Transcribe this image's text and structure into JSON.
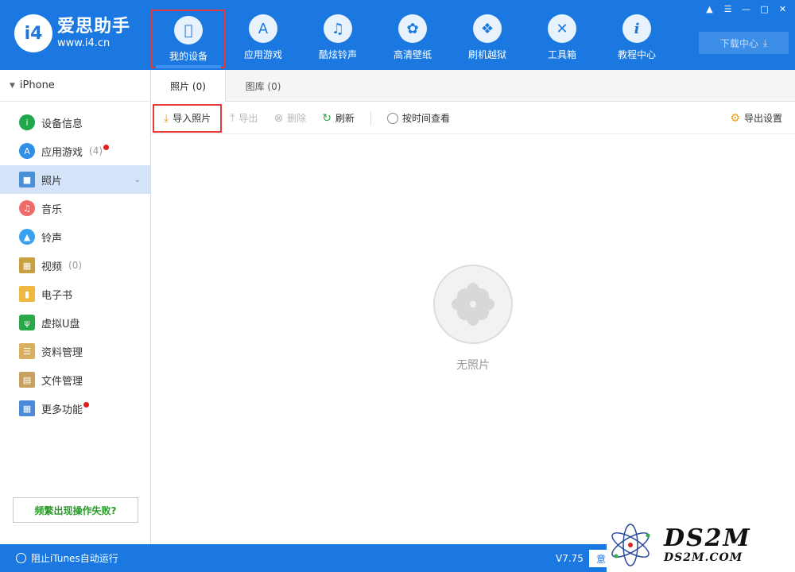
{
  "app": {
    "logo_mark": "i4",
    "name": "爱思助手",
    "url": "www.i4.cn"
  },
  "nav": [
    {
      "label": "我的设备",
      "icon": "apple-icon",
      "active": true
    },
    {
      "label": "应用游戏",
      "icon": "app-store-icon"
    },
    {
      "label": "酷炫铃声",
      "icon": "bell-icon"
    },
    {
      "label": "高清壁纸",
      "icon": "flower-icon"
    },
    {
      "label": "刷机越狱",
      "icon": "dropbox-icon"
    },
    {
      "label": "工具箱",
      "icon": "tools-icon"
    },
    {
      "label": "教程中心",
      "icon": "info-icon"
    }
  ],
  "download_center": "下载中心",
  "device": "iPhone",
  "sidebar": {
    "items": [
      {
        "label": "设备信息",
        "icon": "info-icon",
        "color": "#1ea84a"
      },
      {
        "label": "应用游戏",
        "count": "(4)",
        "dot": true,
        "icon": "app-store-icon",
        "color": "#2f8ee8"
      },
      {
        "label": "照片",
        "active": true,
        "icon": "photo-icon",
        "color": "#4a90d9"
      },
      {
        "label": "音乐",
        "icon": "music-icon",
        "color": "#f06a6a"
      },
      {
        "label": "铃声",
        "icon": "bell-icon",
        "color": "#3aa0f0"
      },
      {
        "label": "视频",
        "count": "(0)",
        "icon": "film-icon",
        "color": "#c8a040"
      },
      {
        "label": "电子书",
        "icon": "book-icon",
        "color": "#f0b840"
      },
      {
        "label": "虚拟U盘",
        "icon": "usb-icon",
        "color": "#2aa84a"
      },
      {
        "label": "资料管理",
        "icon": "contacts-icon",
        "color": "#d8b060"
      },
      {
        "label": "文件管理",
        "icon": "file-icon",
        "color": "#c8a060"
      },
      {
        "label": "更多功能",
        "dot": true,
        "icon": "grid-icon",
        "color": "#4a8ad8"
      }
    ],
    "help_button": "频繁出现操作失败?"
  },
  "tabs": [
    {
      "label": "照片 (0)",
      "active": true
    },
    {
      "label": "图库 (0)"
    }
  ],
  "toolbar": {
    "import": "导入照片",
    "export": "导出",
    "delete": "删除",
    "refresh": "刷新",
    "by_time": "按时间查看",
    "export_settings": "导出设置"
  },
  "empty_text": "无照片",
  "status": {
    "block_itunes": "阻止iTunes自动运行",
    "version": "V7.75",
    "feedback": "意"
  },
  "watermark": {
    "big": "DS2M",
    "small": "DS2M.COM"
  }
}
